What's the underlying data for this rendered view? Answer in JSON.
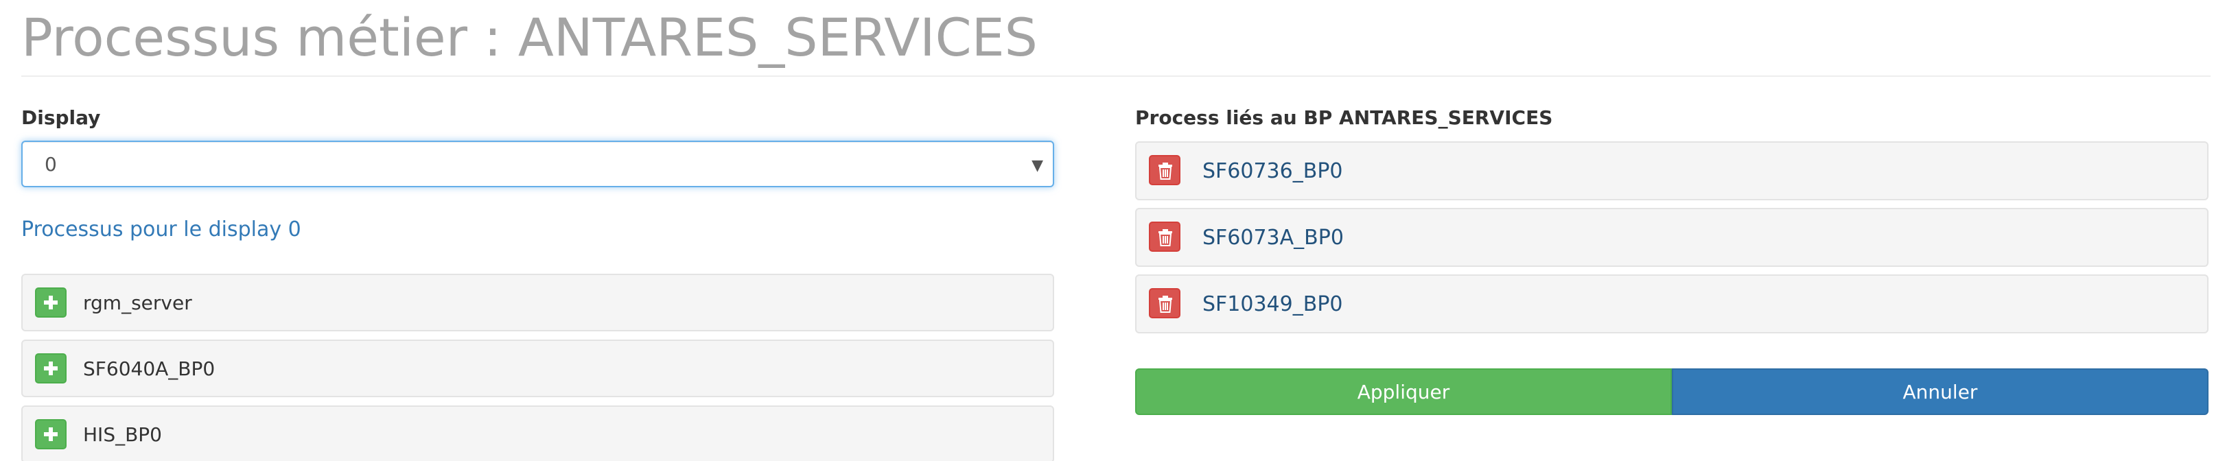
{
  "page": {
    "title": "Processus métier : ANTARES_SERVICES"
  },
  "display_select": {
    "label": "Display",
    "value": "0"
  },
  "left": {
    "heading": "Processus pour le display 0",
    "items": [
      {
        "label": "rgm_server",
        "icon": "plus-icon"
      },
      {
        "label": "SF6040A_BP0",
        "icon": "plus-icon"
      },
      {
        "label": "HIS_BP0",
        "icon": "plus-icon"
      }
    ]
  },
  "right": {
    "heading": "Process liés au BP ANTARES_SERVICES",
    "items": [
      {
        "label": "SF60736_BP0",
        "icon": "trash-icon"
      },
      {
        "label": "SF6073A_BP0",
        "icon": "trash-icon"
      },
      {
        "label": "SF10349_BP0",
        "icon": "trash-icon"
      }
    ]
  },
  "actions": {
    "apply_label": "Appliquer",
    "cancel_label": "Annuler"
  },
  "colors": {
    "add": "#5cb85c",
    "delete": "#d9534f",
    "primary": "#337ab7",
    "link": "#23527c",
    "title": "#a3a3a3"
  }
}
